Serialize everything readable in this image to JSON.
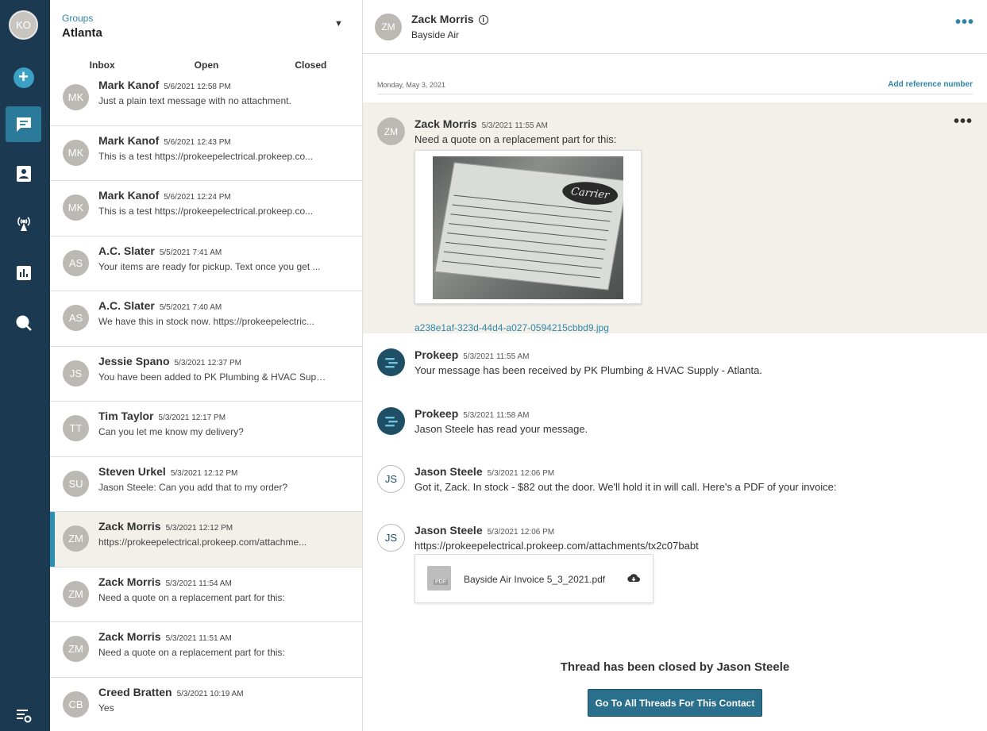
{
  "rail": {
    "user_initials": "KO",
    "items": [
      "plus-icon",
      "chat-icon",
      "contacts-icon",
      "broadcast-icon",
      "reports-icon",
      "search-icon",
      "settings-icon"
    ]
  },
  "groups": {
    "caption": "Groups",
    "name": "Atlanta"
  },
  "tabs": [
    {
      "label": "Inbox"
    },
    {
      "label": "Open"
    },
    {
      "label": "Closed",
      "active": true
    }
  ],
  "threads": [
    {
      "initials": "MK",
      "name": "Mark Kanof",
      "time": "5/6/2021 12:58 PM",
      "preview": "Just a plain text message with no attachment."
    },
    {
      "initials": "MK",
      "name": "Mark Kanof",
      "time": "5/6/2021 12:43 PM",
      "preview": "This is a test https://prokeepelectrical.prokeep.co..."
    },
    {
      "initials": "MK",
      "name": "Mark Kanof",
      "time": "5/6/2021 12:24 PM",
      "preview": "This is a test https://prokeepelectrical.prokeep.co..."
    },
    {
      "initials": "AS",
      "name": "A.C. Slater",
      "time": "5/5/2021 7:41 AM",
      "preview": "Your items are ready for pickup. Text once you get ..."
    },
    {
      "initials": "AS",
      "name": "A.C. Slater",
      "time": "5/5/2021 7:40 AM",
      "preview": "We have this in stock now. https://prokeepelectric..."
    },
    {
      "initials": "JS",
      "name": "Jessie Spano",
      "time": "5/3/2021 12:37 PM",
      "preview": "You have been added to PK Plumbing & HVAC Suppl..."
    },
    {
      "initials": "TT",
      "name": "Tim Taylor",
      "time": "5/3/2021 12:17 PM",
      "preview": "Can you let me know my delivery?"
    },
    {
      "initials": "SU",
      "name": "Steven Urkel",
      "time": "5/3/2021 12:12 PM",
      "preview": "Jason Steele: Can you add that to my order?"
    },
    {
      "initials": "ZM",
      "name": "Zack Morris",
      "time": "5/3/2021 12:12 PM",
      "preview": "https://prokeepelectrical.prokeep.com/attachme...",
      "selected": true
    },
    {
      "initials": "ZM",
      "name": "Zack Morris",
      "time": "5/3/2021 11:54 AM",
      "preview": "Need a quote on a replacement part for this:"
    },
    {
      "initials": "ZM",
      "name": "Zack Morris",
      "time": "5/3/2021 11:51 AM",
      "preview": "Need a quote on a replacement part for this:"
    },
    {
      "initials": "CB",
      "name": "Creed Bratten",
      "time": "5/3/2021 10:19 AM",
      "preview": "Yes"
    }
  ],
  "conversation": {
    "contact_initials": "ZM",
    "contact_name": "Zack Morris",
    "contact_company": "Bayside Air",
    "date": "Monday, May 3, 2021",
    "add_reference": "Add reference number",
    "messages": [
      {
        "initials": "ZM",
        "name": "Zack Morris",
        "time": "5/3/2021 11:55 AM",
        "body": "Need a quote on a replacement part for this:",
        "attachment": "a238e1af-323d-44d4-a027-0594215cbbd9.jpg",
        "image_text": "Carrier"
      },
      {
        "initials": "",
        "name": "Prokeep",
        "time": "5/3/2021 11:55 AM",
        "body": "Your message has been received by PK Plumbing & HVAC Supply - Atlanta."
      },
      {
        "initials": "",
        "name": "Prokeep",
        "time": "5/3/2021 11:58 AM",
        "body": "Jason Steele has read your message."
      },
      {
        "initials": "JS",
        "name": "Jason Steele",
        "time": "5/3/2021 12:06 PM",
        "body": "Got it, Zack.  In stock - $82 out the door.  We'll hold it in will call.  Here's a PDF of your invoice:"
      },
      {
        "initials": "JS",
        "name": "Jason Steele",
        "time": "5/3/2021 12:06 PM",
        "body": "https://prokeepelectrical.prokeep.com/attachments/tx2c07babt",
        "file": "Bayside Air Invoice 5_3_2021.pdf"
      }
    ],
    "closed_notice": "Thread has been closed by Jason Steele",
    "go_button": "Go To All Threads For This Contact"
  },
  "colors": {
    "rail": "#1b3a52",
    "accent": "#2e86a8",
    "highlight": "#f3f0ea"
  }
}
